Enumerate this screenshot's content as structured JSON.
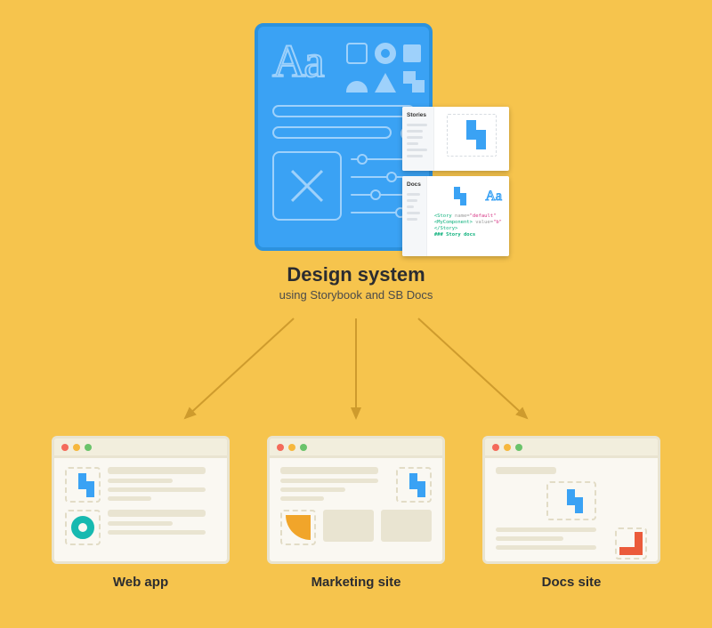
{
  "design_system": {
    "title": "Design system",
    "subtitle": "using Storybook and SB Docs",
    "typography_sample": "Aa",
    "panels": {
      "stories_label": "Stories",
      "docs_label": "Docs",
      "docs_typography_sample": "Aa",
      "code_snippet": {
        "line1_open": "<Story",
        "line1_attr_name": "name=",
        "line1_attr_value": "\"default\"",
        "line2": "<MyComponent>",
        "line2_attr": "value=",
        "line2_val": "\"b\"",
        "line3": "</Story>",
        "footer": "### Story docs"
      }
    }
  },
  "targets": {
    "web": "Web app",
    "marketing": "Marketing site",
    "docs": "Docs site"
  },
  "colors": {
    "background": "#F6C44D",
    "primary": "#3AA2F4",
    "teal": "#17B9B0",
    "amber": "#F1A52A",
    "red": "#EB5B3B"
  }
}
